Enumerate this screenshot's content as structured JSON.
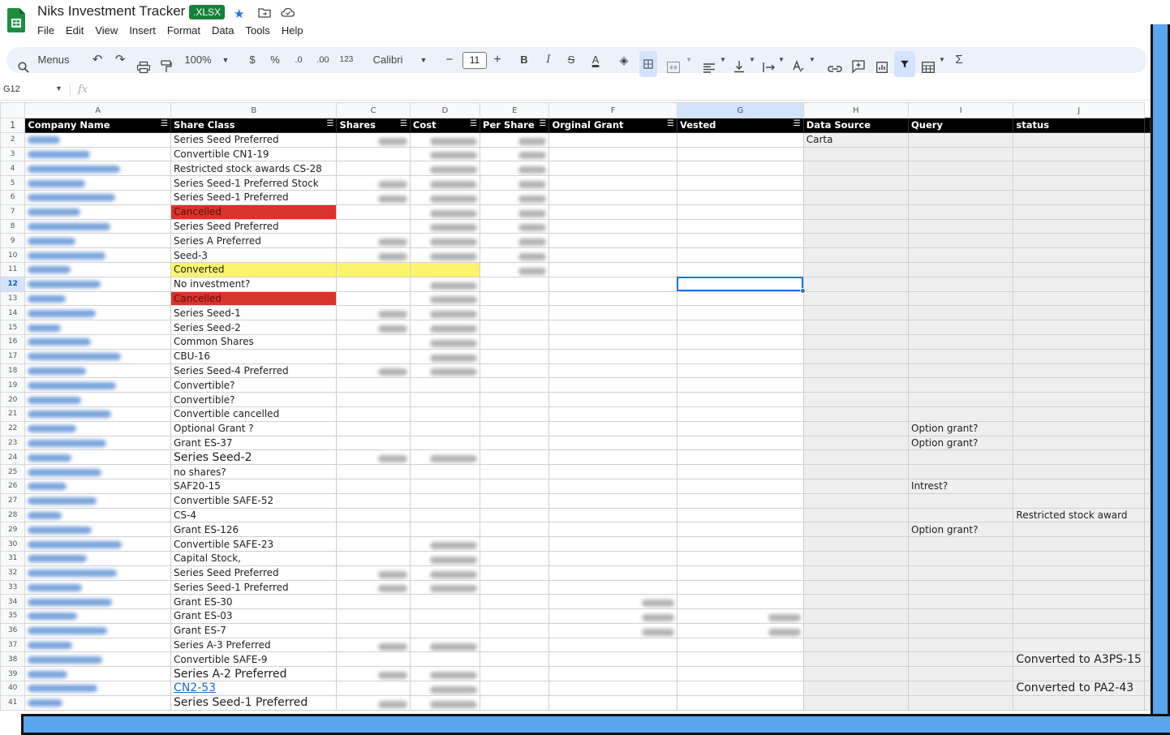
{
  "app": {
    "title": "Niks Investment Tracker",
    "badge": ".XLSX",
    "menu": [
      "File",
      "Edit",
      "View",
      "Insert",
      "Format",
      "Data",
      "Tools",
      "Help"
    ]
  },
  "toolbar": {
    "search_label": "Menus",
    "zoom": "100%",
    "currency": "$",
    "percent": "%",
    "dec_decrease": ".0",
    "dec_increase": ".00",
    "format_123": "123",
    "font": "Calibri",
    "font_size": "11",
    "minus": "−",
    "plus": "+",
    "bold": "B",
    "italic": "I",
    "strike": "S",
    "text_color": "A",
    "sum": "Σ"
  },
  "formula_bar": {
    "cell_ref": "G12",
    "fx": "fx",
    "value": ""
  },
  "columns": [
    "A",
    "B",
    "C",
    "D",
    "E",
    "F",
    "G",
    "H",
    "I",
    "J"
  ],
  "header_row": [
    "Company Name",
    "Share Class",
    "Shares",
    "Cost",
    "Per Share",
    "Orginal Grant",
    "Vested",
    "Data Source",
    "Query",
    "status"
  ],
  "rows": [
    {
      "n": "2",
      "b": "Series Seed Preferred",
      "h": "Carta",
      "i": "",
      "j": ""
    },
    {
      "n": "3",
      "b": "Convertible CN1-19",
      "h": "",
      "i": "",
      "j": ""
    },
    {
      "n": "4",
      "b": "Restricted stock awards CS-28",
      "h": "",
      "i": "",
      "j": ""
    },
    {
      "n": "5",
      "b": "Series Seed-1 Preferred Stock",
      "h": "",
      "i": "",
      "j": ""
    },
    {
      "n": "6",
      "b": "Series Seed-1 Preferred",
      "h": "",
      "i": "",
      "j": ""
    },
    {
      "n": "7",
      "b": "Cancelled",
      "h": "",
      "i": "",
      "j": ""
    },
    {
      "n": "8",
      "b": "Series Seed Preferred",
      "h": "",
      "i": "",
      "j": ""
    },
    {
      "n": "9",
      "b": "Series A Preferred",
      "h": "",
      "i": "",
      "j": ""
    },
    {
      "n": "10",
      "b": "Seed-3",
      "h": "",
      "i": "",
      "j": ""
    },
    {
      "n": "11",
      "b": "Converted",
      "h": "",
      "i": "",
      "j": ""
    },
    {
      "n": "12",
      "b": "No investment?",
      "h": "",
      "i": "",
      "j": ""
    },
    {
      "n": "13",
      "b": "Cancelled",
      "h": "",
      "i": "",
      "j": ""
    },
    {
      "n": "14",
      "b": "Series Seed-1",
      "h": "",
      "i": "",
      "j": ""
    },
    {
      "n": "15",
      "b": "Series Seed-2",
      "h": "",
      "i": "",
      "j": ""
    },
    {
      "n": "16",
      "b": "Common Shares",
      "h": "",
      "i": "",
      "j": ""
    },
    {
      "n": "17",
      "b": "CBU-16",
      "h": "",
      "i": "",
      "j": ""
    },
    {
      "n": "18",
      "b": "Series Seed-4 Preferred",
      "h": "",
      "i": "",
      "j": ""
    },
    {
      "n": "19",
      "b": "Convertible?",
      "h": "",
      "i": "",
      "j": ""
    },
    {
      "n": "20",
      "b": "Convertible?",
      "h": "",
      "i": "",
      "j": ""
    },
    {
      "n": "21",
      "b": "Convertible cancelled",
      "h": "",
      "i": "",
      "j": ""
    },
    {
      "n": "22",
      "b": "Optional Grant ?",
      "h": "",
      "i": "Option grant?",
      "j": ""
    },
    {
      "n": "23",
      "b": "Grant ES-37",
      "h": "",
      "i": "Option grant?",
      "j": ""
    },
    {
      "n": "24",
      "b": "Series Seed-2",
      "h": "",
      "i": "",
      "j": ""
    },
    {
      "n": "25",
      "b": "no shares?",
      "h": "",
      "i": "",
      "j": ""
    },
    {
      "n": "26",
      "b": "SAF20-15",
      "h": "",
      "i": "Intrest?",
      "j": ""
    },
    {
      "n": "27",
      "b": "Convertible SAFE-52",
      "h": "",
      "i": "",
      "j": ""
    },
    {
      "n": "28",
      "b": "CS-4",
      "h": "",
      "i": "",
      "j": "Restricted stock award"
    },
    {
      "n": "29",
      "b": "Grant ES-126",
      "h": "",
      "i": "Option grant?",
      "j": ""
    },
    {
      "n": "30",
      "b": "Convertible SAFE-23",
      "h": "",
      "i": "",
      "j": ""
    },
    {
      "n": "31",
      "b": "Capital Stock,",
      "h": "",
      "i": "",
      "j": ""
    },
    {
      "n": "32",
      "b": "Series Seed Preferred",
      "h": "",
      "i": "",
      "j": ""
    },
    {
      "n": "33",
      "b": "Series Seed-1 Preferred",
      "h": "",
      "i": "",
      "j": ""
    },
    {
      "n": "34",
      "b": "Grant ES-30",
      "h": "",
      "i": "",
      "j": ""
    },
    {
      "n": "35",
      "b": "Grant ES-03",
      "h": "",
      "i": "",
      "j": ""
    },
    {
      "n": "36",
      "b": "Grant ES-7",
      "h": "",
      "i": "",
      "j": ""
    },
    {
      "n": "37",
      "b": "Series A-3 Preferred",
      "h": "",
      "i": "",
      "j": ""
    },
    {
      "n": "38",
      "b": "Convertible SAFE-9",
      "h": "",
      "i": "",
      "j": "Converted to A3PS-15"
    },
    {
      "n": "39",
      "b": "Series A-2 Preferred",
      "h": "",
      "i": "",
      "j": ""
    },
    {
      "n": "40",
      "b": "CN2-53",
      "h": "",
      "i": "",
      "j": "Converted to PA2-43"
    },
    {
      "n": "41",
      "b": "Series Seed-1 Preferred",
      "h": "",
      "i": "",
      "j": ""
    }
  ]
}
